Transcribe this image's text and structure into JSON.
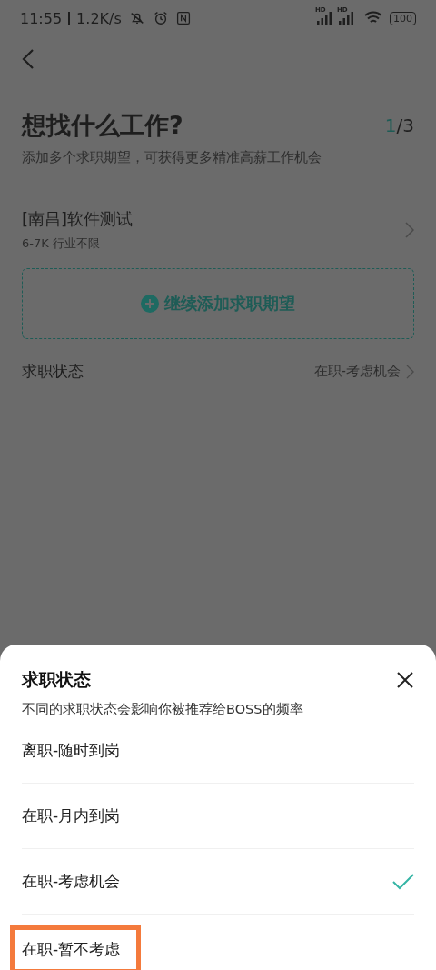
{
  "status_bar": {
    "time": "11:55",
    "speed": "1.2K/s",
    "signals": [
      {
        "label": "HD"
      },
      {
        "label": "HD"
      }
    ],
    "battery": "100"
  },
  "page": {
    "title": "想找什么工作?",
    "step_current": "1",
    "step_total": "/3",
    "subtitle": "添加多个求职期望，可获得更多精准高薪工作机会",
    "expectations": [
      {
        "title": "[南昌]软件测试",
        "detail": "6-7K 行业不限"
      }
    ],
    "add_button": "继续添加求职期望",
    "status_label": "求职状态",
    "status_value": "在职-考虑机会"
  },
  "sheet": {
    "title": "求职状态",
    "subtitle": "不同的求职状态会影响你被推荐给BOSS的频率",
    "options": [
      {
        "label": "离职-随时到岗",
        "selected": false,
        "highlighted": false
      },
      {
        "label": "在职-月内到岗",
        "selected": false,
        "highlighted": false
      },
      {
        "label": "在职-考虑机会",
        "selected": true,
        "highlighted": false
      },
      {
        "label": "在职-暂不考虑",
        "selected": false,
        "highlighted": true
      }
    ]
  }
}
